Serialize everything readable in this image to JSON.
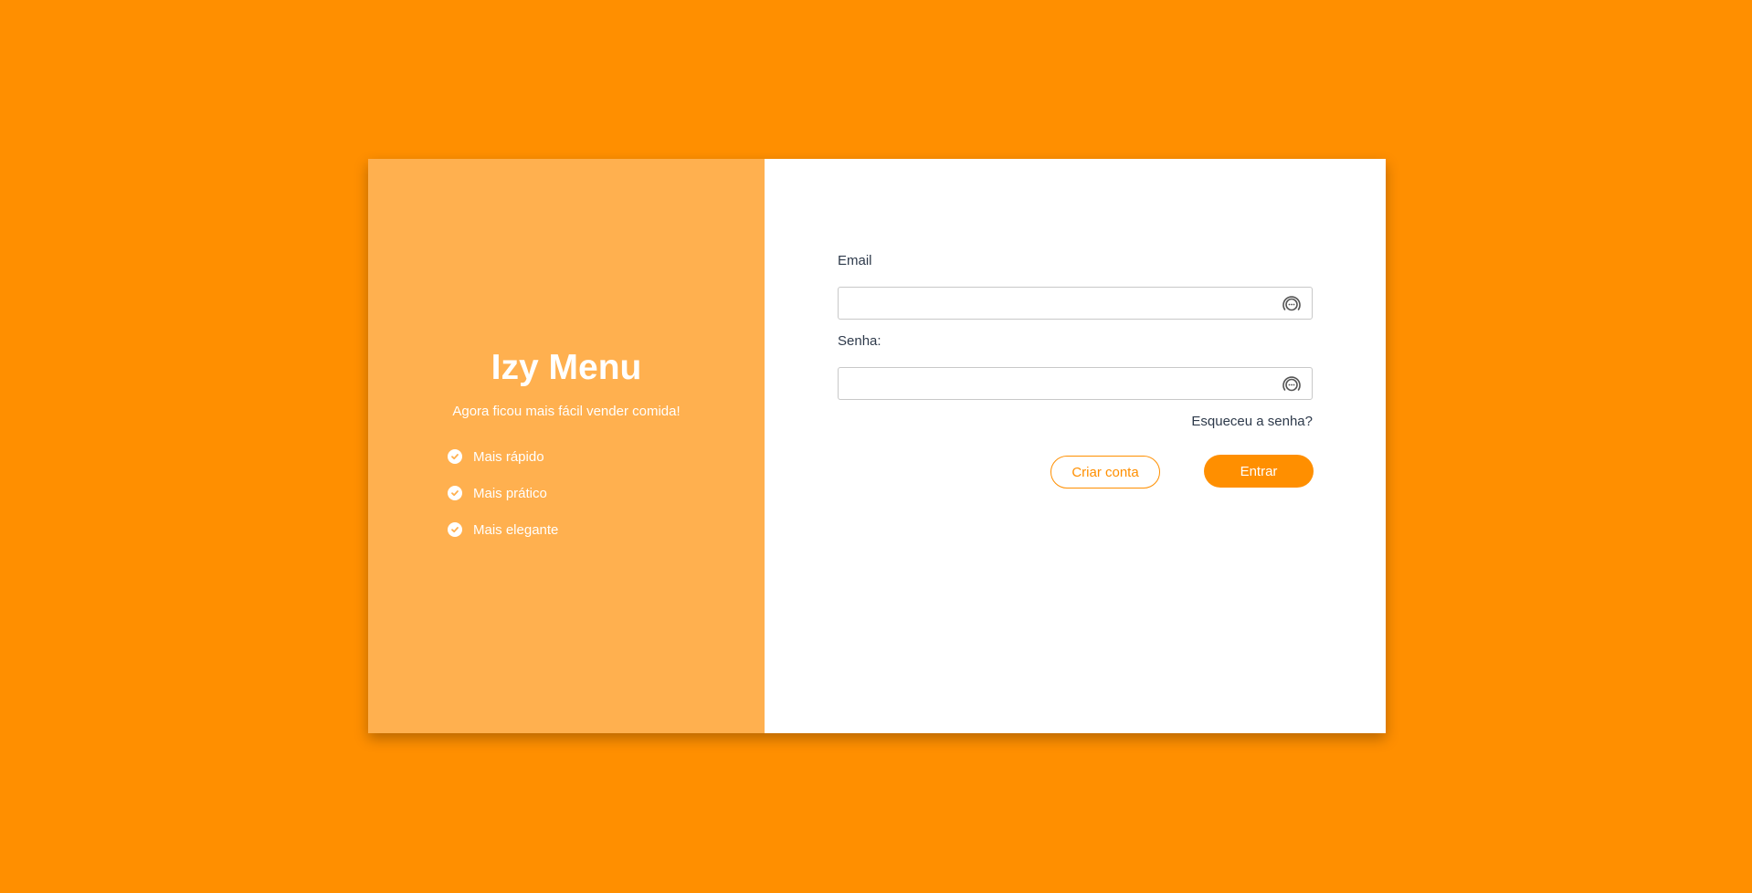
{
  "colors": {
    "background": "#ff8f00",
    "left_panel": "#ffb04f",
    "accent": "#ff8f00",
    "text": "#2e3a4b"
  },
  "brand": {
    "title": "Izy Menu",
    "subtitle": "Agora ficou mais fácil vender comida!"
  },
  "features": [
    {
      "label": "Mais rápido",
      "icon": "check-circle-icon"
    },
    {
      "label": "Mais prático",
      "icon": "check-circle-icon"
    },
    {
      "label": "Mais elegante",
      "icon": "check-circle-icon"
    }
  ],
  "form": {
    "email_label": "Email",
    "email_value": "",
    "email_icon": "password-manager-icon",
    "password_label": "Senha:",
    "password_value": "",
    "password_icon": "password-manager-icon",
    "forgot_label": "Esqueceu a senha?",
    "create_account_label": "Criar conta",
    "submit_label": "Entrar"
  }
}
